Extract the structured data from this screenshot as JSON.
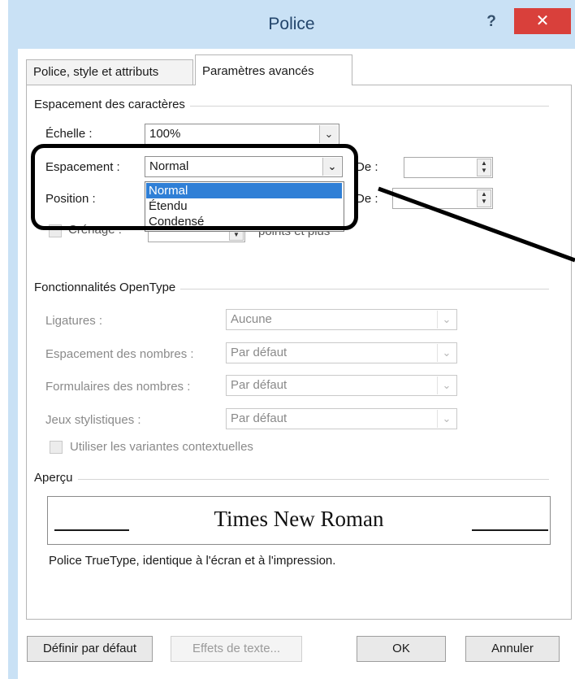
{
  "window": {
    "title": "Police",
    "help_label": "?",
    "close_label": "✕"
  },
  "tabs": [
    {
      "label": "Police, style et attributs",
      "active": false
    },
    {
      "label": "Paramètres avancés",
      "active": true
    }
  ],
  "spacing_group": {
    "title": "Espacement des caractères",
    "scale_label": "Échelle :",
    "scale_value": "100%",
    "spacing_label": "Espacement :",
    "spacing_value": "Normal",
    "spacing_options": [
      "Normal",
      "Étendu",
      "Condensé"
    ],
    "spacing_selected": "Normal",
    "spacing_de_label": "De :",
    "position_label": "Position :",
    "position_de_label": "De :",
    "kerning_label": "Crénage :",
    "kerning_suffix": "points et plus"
  },
  "opentype_group": {
    "title": "Fonctionnalités OpenType",
    "ligatures_label": "Ligatures :",
    "ligatures_value": "Aucune",
    "number_spacing_label": "Espacement des nombres :",
    "number_spacing_value": "Par défaut",
    "number_forms_label": "Formulaires des nombres :",
    "number_forms_value": "Par défaut",
    "stylistic_sets_label": "Jeux stylistiques :",
    "stylistic_sets_value": "Par défaut",
    "contextual_alternates_label": "Utiliser les variantes contextuelles"
  },
  "preview_group": {
    "title": "Aperçu",
    "sample_text": "Times New Roman",
    "description": "Police TrueType, identique à l'écran et à l'impression."
  },
  "buttons": {
    "set_default": "Définir par défaut",
    "text_effects": "Effets de texte...",
    "ok": "OK",
    "cancel": "Annuler"
  },
  "icons": {
    "dropdown": "chevron-down-icon",
    "spin": "spin-arrows-icon",
    "help": "help-icon",
    "close": "close-icon"
  },
  "colors": {
    "title_bar": "#c9e1f5",
    "close_button": "#d9403b",
    "selection": "#2f7fd6",
    "annotation": "#000000"
  }
}
